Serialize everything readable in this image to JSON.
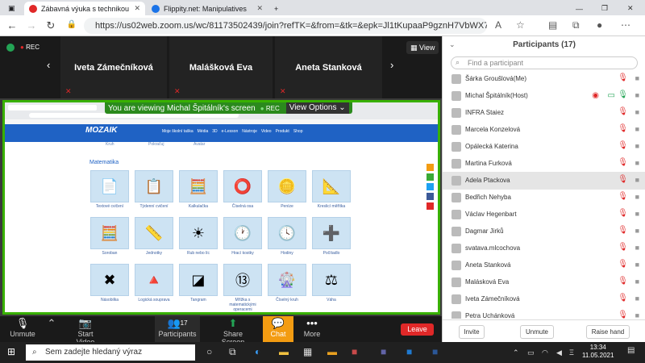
{
  "browser": {
    "tabs": [
      {
        "label": "Zábavná výuka s technikou",
        "color": "#e02828"
      },
      {
        "label": "Flippity.net: Manipulatives",
        "color": "#1a73e8"
      }
    ],
    "url": "https://us02web.zoom.us/wc/81173502439/join?refTK=&from=&tk=&epk=Jl1tKupaaP9gznH7VbWX7ZL7OX..."
  },
  "zoom": {
    "rec_label": "REC",
    "view_label": "View",
    "video_tiles": [
      "Iveta Zámečníková",
      "Malášková Eva",
      "Aneta Stanková"
    ],
    "share_banner": "You are viewing Michal Špitálník's screen",
    "share_rec": "REC",
    "view_options": "View Options",
    "toolbar": {
      "unmute": "Unmute",
      "start_video": "Start Video",
      "participants": "Participants",
      "participants_count": "17",
      "share_screen": "Share Screen",
      "chat": "Chat",
      "more": "More",
      "leave": "Leave"
    }
  },
  "shared": {
    "logo": "MOZAIK",
    "nav": [
      "Moje školní taška",
      "Média",
      "3D",
      "e-Lesson",
      "Nástroje",
      "Video",
      "Produkt",
      "Shop"
    ],
    "sub_top": [
      "Kruh",
      "Pokračuj",
      "Avatar"
    ],
    "section_title": "Matematika",
    "tiles": [
      [
        "Textové cvičení",
        "Týdenní cvičení",
        "Kalkulačka",
        "Číselná osa",
        "Peníze",
        "Kreslicí měřítka"
      ],
      [
        "Soroban",
        "Jednotky",
        "Rub nebo líc",
        "Hrací kostky",
        "Hodiny",
        "Počítadlo"
      ],
      [
        "Násobilka",
        "Logická soupravа",
        "Tangram",
        "Mřížka s matematickými operacemi",
        "Číselný kruh",
        "Váha"
      ]
    ]
  },
  "participants": {
    "title": "Participants (17)",
    "find_placeholder": "Find a participant",
    "list": [
      "Šárka Groušlová(Me)",
      "Michal Špitálník(Host)",
      "INFRA Staiez",
      "Marcela Konzelová",
      "Opálecká Katerina",
      "Martina Furková",
      "Adela Ptackova",
      "Bedřich Nehyba",
      "Václav Hegenbart",
      "Dagmar Jirků",
      "svatava.mlcochova",
      "Aneta Stanková",
      "Malásková Eva",
      "Iveta Zámečníková",
      "Petra Uchánková"
    ],
    "invite": "Invite",
    "unmute": "Unmute",
    "raise_hand": "Raise hand"
  },
  "taskbar": {
    "search_placeholder": "Sem zadejte hledaný výraz",
    "time": "13:34",
    "date": "11.05.2021"
  }
}
